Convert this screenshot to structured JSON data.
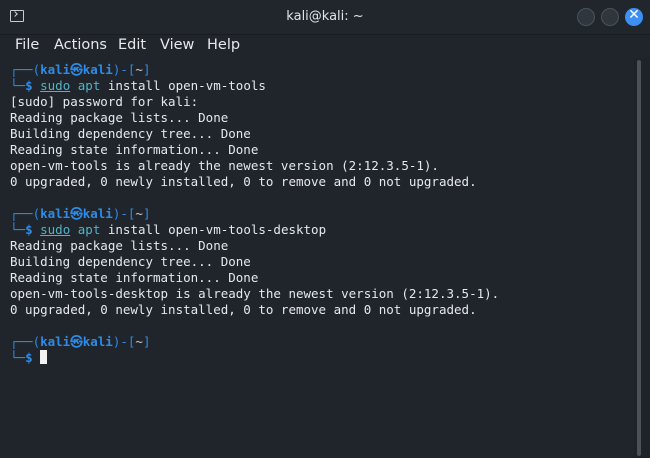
{
  "window": {
    "title": "kali@kali: ~",
    "app_icon": "terminal-icon",
    "close_glyph": "✕"
  },
  "menu": [
    "File",
    "Actions",
    "Edit",
    "View",
    "Help"
  ],
  "colors": {
    "background": "#1f252b",
    "prompt": "#2e8be6",
    "command": "#4fb3c9",
    "text": "#e5e8eb",
    "close_button": "#3d8ff2"
  },
  "terminal": {
    "prompt_top_prefix": "┌──(",
    "prompt_user": "kali",
    "prompt_at": "㉿",
    "prompt_host": "kali",
    "prompt_mid": ")-[",
    "prompt_dir": "~",
    "prompt_end": "]",
    "prompt_bottom_prefix": "└─",
    "prompt_dollar": "$",
    "blocks": [
      {
        "cmd_sudo": "sudo",
        "cmd_apt": "apt",
        "cmd_rest": " install open-vm-tools",
        "output": [
          "[sudo] password for kali:",
          "Reading package lists... Done",
          "Building dependency tree... Done",
          "Reading state information... Done",
          "open-vm-tools is already the newest version (2:12.3.5-1).",
          "0 upgraded, 0 newly installed, 0 to remove and 0 not upgraded."
        ]
      },
      {
        "cmd_sudo": "sudo",
        "cmd_apt": "apt",
        "cmd_rest": " install open-vm-tools-desktop",
        "output": [
          "Reading package lists... Done",
          "Building dependency tree... Done",
          "Reading state information... Done",
          "open-vm-tools-desktop is already the newest version (2:12.3.5-1).",
          "0 upgraded, 0 newly installed, 0 to remove and 0 not upgraded."
        ]
      }
    ]
  }
}
